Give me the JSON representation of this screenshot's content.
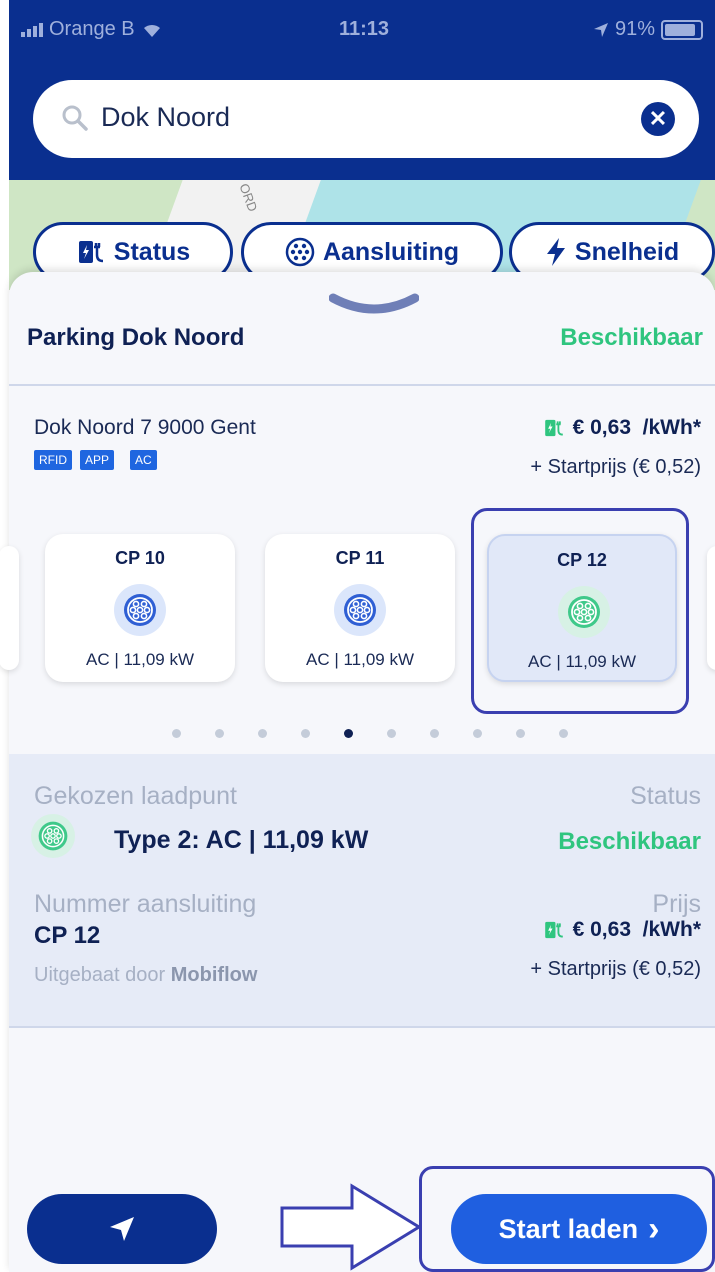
{
  "status_bar": {
    "carrier": "Orange B",
    "time": "11:13",
    "battery": "91%"
  },
  "search": {
    "value": "Dok Noord"
  },
  "map": {
    "street_label": "ORD"
  },
  "filters": [
    {
      "label": "Status"
    },
    {
      "label": "Aansluiting"
    },
    {
      "label": "Snelheid"
    }
  ],
  "location": {
    "name": "Parking Dok Noord",
    "availability": "Beschikbaar",
    "address": "Dok Noord 7 9000 Gent",
    "tags": [
      "RFID",
      "APP",
      "AC"
    ],
    "price": "€ 0,63  /kWh*",
    "start_price": "+ Startprijs (€ 0,52)"
  },
  "charge_points": [
    {
      "id": "CP 10",
      "spec": "AC | 11,09 kW",
      "selected": false
    },
    {
      "id": "CP 11",
      "spec": "AC | 11,09 kW",
      "selected": false
    },
    {
      "id": "CP 12",
      "spec": "AC | 11,09 kW",
      "selected": true
    }
  ],
  "pager": {
    "count": 10,
    "active_index": 4
  },
  "chosen": {
    "label_point": "Gekozen laadpunt",
    "label_status": "Status",
    "type": "Type 2: AC | 11,09 kW",
    "status": "Beschikbaar",
    "label_number": "Nummer aansluiting",
    "label_price": "Prijs",
    "number": "CP 12",
    "price": "€ 0,63  /kWh*",
    "operated_by_prefix": "Uitgebaat door",
    "operator": "Mobiflow",
    "start_price": "+ Startprijs (€ 0,52)"
  },
  "actions": {
    "start_label": "Start laden",
    "start_chevron": "›"
  },
  "colors": {
    "primary": "#0a2f8f",
    "accent": "#1f5fe0",
    "available": "#2fc57f"
  },
  "icons": [
    "search-icon",
    "clear-icon",
    "charger-icon",
    "connector-icon",
    "bolt-icon",
    "chevron-down-icon",
    "navigation-icon",
    "arrow-right-icon"
  ]
}
